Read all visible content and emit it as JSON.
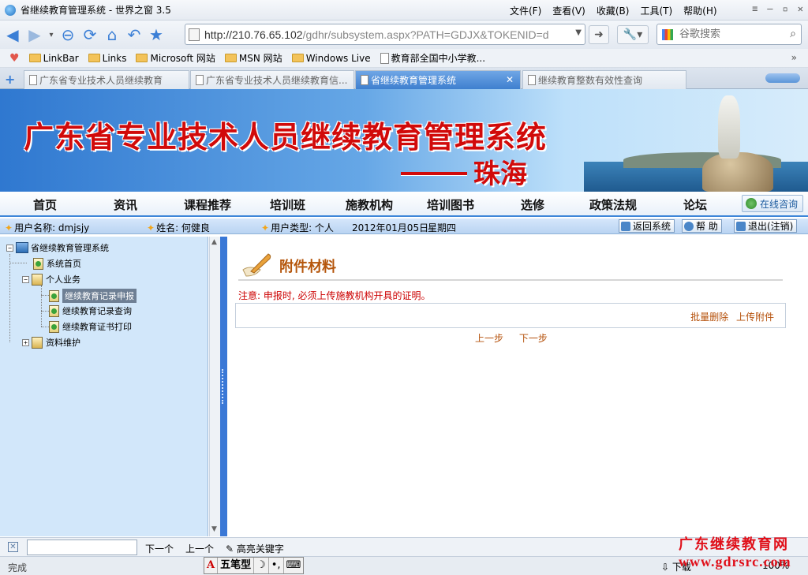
{
  "window": {
    "title": "省继续教育管理系统 - 世界之窗 3.5",
    "menu": [
      "文件(F)",
      "查看(V)",
      "收藏(B)",
      "工具(T)",
      "帮助(H)"
    ]
  },
  "navbar": {
    "url_host": "http://210.76.65.102",
    "url_path": "/gdhr/subsystem.aspx?PATH=GDJX&TOKENID=d",
    "search_placeholder": "谷歌搜索"
  },
  "bookmarks": [
    "LinkBar",
    "Links",
    "Microsoft 网站",
    "MSN 网站",
    "Windows Live",
    "教育部全国中小学教..."
  ],
  "tabs": [
    {
      "label": "广东省专业技术人员继续教育",
      "active": false
    },
    {
      "label": "广东省专业技术人员继续教育信...",
      "active": false
    },
    {
      "label": "省继续教育管理系统",
      "active": true
    },
    {
      "label": "继续教育整数有效性查询",
      "active": false
    }
  ],
  "banner": {
    "title": "广东省专业技术人员继续教育管理系统",
    "city": "珠海"
  },
  "mainnav": {
    "items": [
      "首页",
      "资讯",
      "课程推荐",
      "培训班",
      "施教机构",
      "培训图书",
      "选修",
      "政策法规",
      "论坛"
    ],
    "consult": "在线咨询"
  },
  "infobar": {
    "username_label": "用户名称: dmjsjy",
    "name_label": "姓名: 何健良",
    "usertype_label": "用户类型: 个人",
    "date": "2012年01月05日",
    "weekday": "星期四",
    "return_btn": "返回系统",
    "help_btn": "帮 助",
    "logout_btn": "退出(注销)"
  },
  "tree": {
    "root": "省继续教育管理系统",
    "home": "系统首页",
    "personal": "个人业务",
    "personal_items": [
      "继续教育记录申报",
      "继续教育记录查询",
      "继续教育证书打印"
    ],
    "maintain": "资料维护"
  },
  "content": {
    "section_title": "附件材料",
    "notice": "注意: 申报时, 必须上传施教机构开具的证明。",
    "batch_delete": "批量删除",
    "upload": "上传附件",
    "prev": "上一步",
    "next": "下一步"
  },
  "findbar": {
    "next": "下一个",
    "prev": "上一个",
    "highlight": "高亮关键字"
  },
  "status": {
    "text": "完成",
    "ime_a": "A",
    "ime_label": "五笔型",
    "download": "下载",
    "zoom": "100%"
  },
  "watermark": {
    "line1": "广东继续教育网",
    "line2": "www.gdrsrc.com"
  }
}
